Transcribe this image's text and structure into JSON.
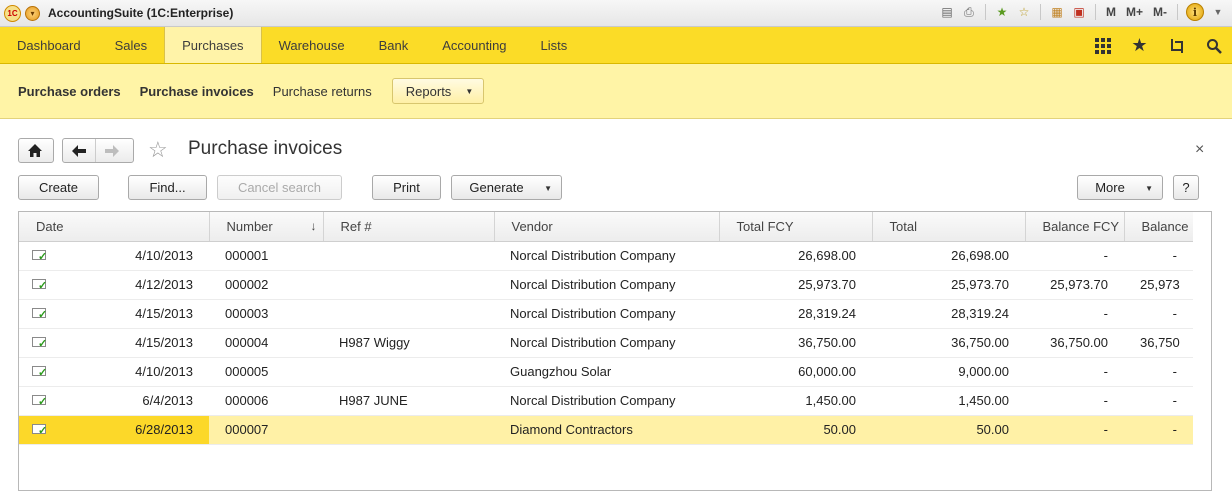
{
  "app": {
    "title": "AccountingSuite  (1C:Enterprise)",
    "logo_text": "1C",
    "toolbar_m": [
      "M",
      "M+",
      "M-"
    ]
  },
  "sections": [
    {
      "label": "Dashboard"
    },
    {
      "label": "Sales"
    },
    {
      "label": "Purchases"
    },
    {
      "label": "Warehouse"
    },
    {
      "label": "Bank"
    },
    {
      "label": "Accounting"
    },
    {
      "label": "Lists"
    }
  ],
  "active_section": "Purchases",
  "nav_panel": {
    "purchase_orders": "Purchase orders",
    "purchase_invoices": "Purchase invoices",
    "purchase_returns": "Purchase returns",
    "reports": "Reports"
  },
  "form": {
    "title": "Purchase invoices",
    "close": "×"
  },
  "commands": {
    "create": "Create",
    "find": "Find...",
    "cancel_search": "Cancel search",
    "print": "Print",
    "generate": "Generate",
    "more": "More",
    "help": "?"
  },
  "table": {
    "columns": [
      "Date",
      "Number",
      "Ref #",
      "Vendor",
      "Total FCY",
      "Total",
      "Balance FCY",
      "Balance"
    ],
    "rows": [
      {
        "date": "4/10/2013",
        "number": "000001",
        "ref": "",
        "vendor": "Norcal Distribution Company",
        "total_fcy": "26,698.00",
        "total": "26,698.00",
        "balance_fcy": "-",
        "balance": "-"
      },
      {
        "date": "4/12/2013",
        "number": "000002",
        "ref": "",
        "vendor": "Norcal Distribution Company",
        "total_fcy": "25,973.70",
        "total": "25,973.70",
        "balance_fcy": "25,973.70",
        "balance": "25,973"
      },
      {
        "date": "4/15/2013",
        "number": "000003",
        "ref": "",
        "vendor": "Norcal Distribution Company",
        "total_fcy": "28,319.24",
        "total": "28,319.24",
        "balance_fcy": "-",
        "balance": "-"
      },
      {
        "date": "4/15/2013",
        "number": "000004",
        "ref": "H987 Wiggy",
        "vendor": "Norcal Distribution Company",
        "total_fcy": "36,750.00",
        "total": "36,750.00",
        "balance_fcy": "36,750.00",
        "balance": "36,750"
      },
      {
        "date": "4/10/2013",
        "number": "000005",
        "ref": "",
        "vendor": "Guangzhou Solar",
        "total_fcy": "60,000.00",
        "total": "9,000.00",
        "balance_fcy": "-",
        "balance": "-"
      },
      {
        "date": "6/4/2013",
        "number": "000006",
        "ref": "H987 JUNE",
        "vendor": "Norcal Distribution Company",
        "total_fcy": "1,450.00",
        "total": "1,450.00",
        "balance_fcy": "-",
        "balance": "-"
      },
      {
        "date": "6/28/2013",
        "number": "000007",
        "ref": "",
        "vendor": "Diamond Contractors",
        "total_fcy": "50.00",
        "total": "50.00",
        "balance_fcy": "-",
        "balance": "-"
      }
    ],
    "selected_row": 6
  },
  "colors": {
    "sections_bg": "#fbdc27",
    "nav_panel_bg": "#fff4a6",
    "selected_row_bg": "#fff1a6",
    "selected_cell_bg": "#fcd829"
  }
}
